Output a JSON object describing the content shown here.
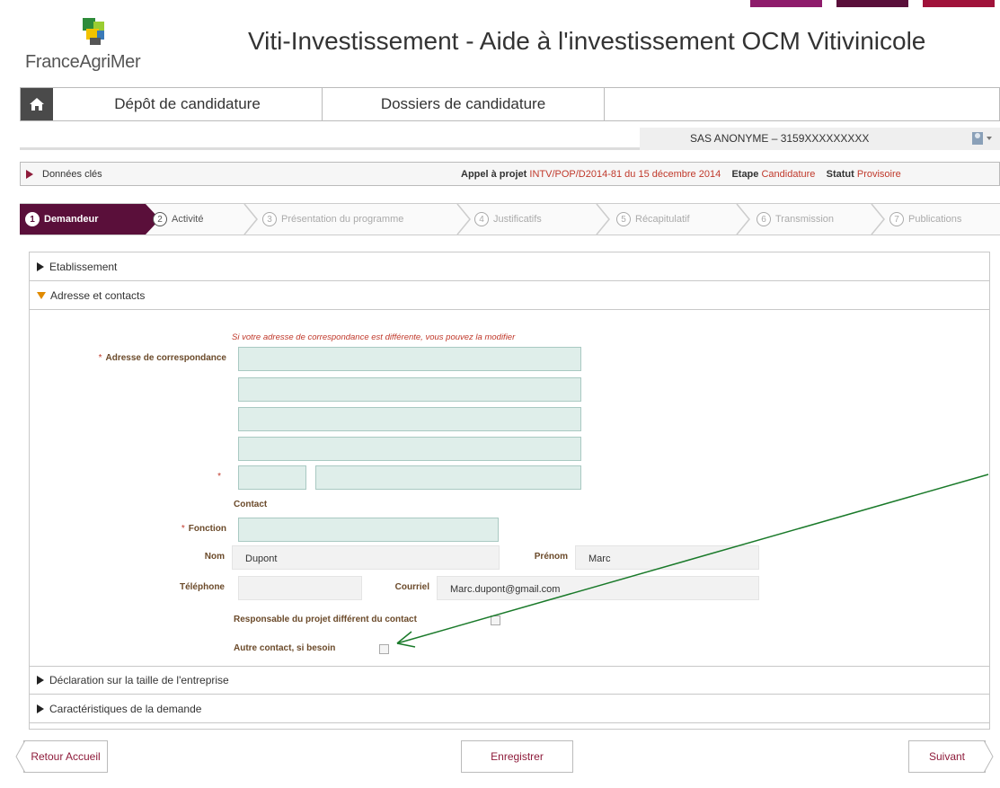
{
  "header": {
    "logo_text": "FranceAgriMer",
    "app_title": "Viti-Investissement - Aide à l'investissement OCM Vitivinicole",
    "top_tab_colors": [
      "#8e1b6b",
      "#5a0f3a",
      "#a0123a"
    ]
  },
  "nav": {
    "home_icon": "home-icon",
    "tabs": [
      {
        "label": "Dépôt de candidature"
      },
      {
        "label": "Dossiers de candidature"
      }
    ]
  },
  "user": {
    "name": "SAS ANONYME – 3159XXXXXXXXX",
    "icon": "user-icon"
  },
  "keybar": {
    "label": "Données clés",
    "appel_label": "Appel à projet",
    "appel_value": "INTV/POP/D2014-81 du 15 décembre 2014",
    "etape_label": "Etape",
    "etape_value": "Candidature",
    "statut_label": "Statut",
    "statut_value": "Provisoire"
  },
  "steps": [
    {
      "num": "1",
      "label": "Demandeur"
    },
    {
      "num": "2",
      "label": "Activité"
    },
    {
      "num": "3",
      "label": "Présentation du programme"
    },
    {
      "num": "4",
      "label": "Justificatifs"
    },
    {
      "num": "5",
      "label": "Récapitulatif"
    },
    {
      "num": "6",
      "label": "Transmission"
    },
    {
      "num": "7",
      "label": "Publications"
    }
  ],
  "sections": {
    "etablissement": "Etablissement",
    "adresse": "Adresse et contacts",
    "declaration": "Déclaration sur la taille de l'entreprise",
    "caracteristiques": "Caractéristiques de la demande"
  },
  "form": {
    "hint": "Si votre adresse de correspondance est différente, vous pouvez la modifier",
    "required_mark": "*",
    "adresse_label": "Adresse de correspondance",
    "contact_title": "Contact",
    "fonction_label": "Fonction",
    "nom_label": "Nom",
    "nom_value": "Dupont",
    "prenom_label": "Prénom",
    "prenom_value": "Marc",
    "telephone_label": "Téléphone",
    "courriel_label": "Courriel",
    "courriel_value": "Marc.dupont@gmail.com",
    "responsable_label": "Responsable du projet différent du contact",
    "autre_contact_label": "Autre contact, si besoin"
  },
  "buttons": {
    "retour": "Retour Accueil",
    "enregistrer": "Enregistrer",
    "suivant": "Suivant"
  },
  "colors": {
    "brand": "#5a0f3a",
    "accent_red": "#c0392b",
    "input_bg": "#dfeeea",
    "annotation_arrow": "#1a7a2a"
  }
}
